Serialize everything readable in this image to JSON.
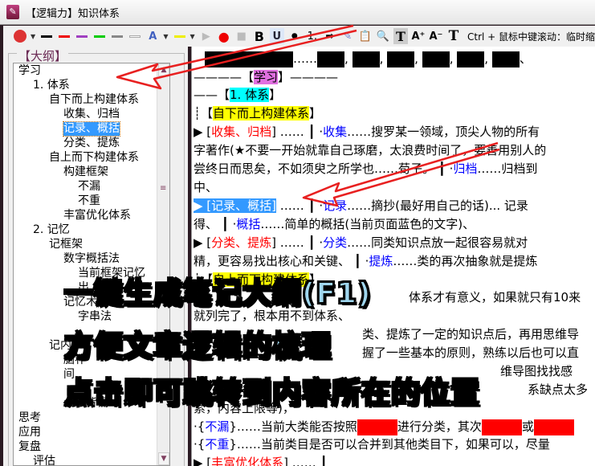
{
  "window": {
    "title": "【逻辑力】知识体系",
    "app_icon": "app-logo-icon"
  },
  "toolbar": {
    "bold": "B",
    "underline": "U",
    "bullet": "●",
    "numbering": "1.",
    "font_A": "A",
    "text_T": "T",
    "grow": "A⁺",
    "shrink": "A⁻",
    "hint": "Ctrl + 鼠标中键滚动：临时缩"
  },
  "outline": {
    "label": "【大纲】",
    "items": [
      {
        "text": "学习",
        "level": 0
      },
      {
        "text": "1. 体系",
        "level": 1
      },
      {
        "text": "自下而上构建体系",
        "level": 2
      },
      {
        "text": "收集、归档",
        "level": 3
      },
      {
        "text": "记录、概括",
        "level": 3,
        "selected": true
      },
      {
        "text": "分类、提炼",
        "level": 3
      },
      {
        "text": "自上而下构建体系",
        "level": 2
      },
      {
        "text": "构建框架",
        "level": 3
      },
      {
        "text": "不漏",
        "level": 4
      },
      {
        "text": "不重",
        "level": 4
      },
      {
        "text": "丰富优化体系",
        "level": 3
      },
      {
        "text": "2. 记忆",
        "level": 1
      },
      {
        "text": "记框架",
        "level": 2
      },
      {
        "text": "数字概括法",
        "level": 3
      },
      {
        "text": "当前框架记忆",
        "level": 4
      },
      {
        "text": "出",
        "level": 4
      },
      {
        "text": "记忆术",
        "level": 3
      },
      {
        "text": "字串法",
        "level": 4
      },
      {
        "text": "",
        "level": 4
      },
      {
        "text": "记内",
        "level": 2
      },
      {
        "text": "脑补",
        "level": 3
      },
      {
        "text": "间",
        "level": 3
      },
      {
        "text": "",
        "level": 3
      },
      {
        "text": "会试背诵",
        "level": 3
      },
      {
        "text": "思考",
        "level": 0
      },
      {
        "text": "应用",
        "level": 0
      },
      {
        "text": "复盘",
        "level": 0
      },
      {
        "text": "评估",
        "level": 1
      }
    ]
  },
  "content": {
    "line0_sep": "……",
    "line0_commas": [
      ",",
      ",",
      ",",
      ",",
      ","
    ],
    "line0_end": "、",
    "h_study": {
      "pre": "————【",
      "text": "学习",
      "post": "】————"
    },
    "h_system": {
      "pre": "——【",
      "text": "1. 体系",
      "post": "】"
    },
    "h_bottomup": {
      "pre": "┊【",
      "text": "自下而上构建体系",
      "post": "】"
    },
    "collect": {
      "arrow": "▶ [",
      "title": "收集、归档",
      "mid": "] …… ┃ ·",
      "k1": "收集",
      "t1": "……搜罗某一领域，顶尖人物的所有"
    },
    "l_zhu": "字著作(★不要一开始就靠自己琢磨，太浪费时间了，要善用别人的",
    "l_chang": {
      "t": "尝终日而思矣，不如须臾之所学也……荀子。 ┃ ·",
      "k": "归档",
      "t2": "……归档到"
    },
    "l_zhong": "中、",
    "record": {
      "arrow": "▶ [",
      "title": "记录、概括",
      "post": "]",
      "mid": " …… ┃ ·",
      "k1": "记录",
      "t1": "……摘抄(最好用自己的话)... 记录"
    },
    "l_de": {
      "t": "得、 ┃ ·",
      "k": "概括",
      "t2": "……简单的概括(当前页面蓝色的文字)、"
    },
    "classify": {
      "arrow": "▶ [",
      "title": "分类、提炼",
      "mid": "] …… ┃ ·",
      "k1": "分类",
      "t1": "……同类知识点放一起很容易就对"
    },
    "l_jing": {
      "t": "精，更容易找出核心和关键、 ┃ ·",
      "k": "提炼",
      "t2": "……类的再次抽象就是提炼"
    },
    "h_topdown": {
      "pre": "┊【",
      "text": "自上而下构建体系",
      "post": "】"
    },
    "l_a": "体系才有意义，如果就只有10来",
    "l_b": "就列完了，根本用不到体系、",
    "l_c": "类、提炼了一定的知识点后，再用思维导",
    "l_d": "握了一些基本的原则，熟练以后也可以直",
    "l_e": "维导图找找感",
    "l_f": "系缺点太多",
    "l_g": "索，内容上限等)，",
    "buleo": {
      "pre": " ·{",
      "k": "不漏",
      "t": "}……当前大类能否按照",
      "t2": "进行分类，其次",
      "t3": "或"
    },
    "buchong": {
      "pre": " ·{",
      "k": "不重",
      "t": "}……当前类目是否可以合并到其他类目下，如果可以，尽量"
    },
    "enrich": {
      "pre": "▶ [",
      "title": "丰富优化体系",
      "post": "] …… ┃"
    }
  },
  "overlay": [
    "一键生成笔记大纲(F1)",
    "方便文章逻辑的梳理",
    "点击即可跳转到内容所在的位置"
  ],
  "colors": {
    "accent_red": "#ff0000",
    "link_blue": "#0000ff",
    "selection": "#3399ff",
    "overlay_text": "#9fd6ee"
  }
}
